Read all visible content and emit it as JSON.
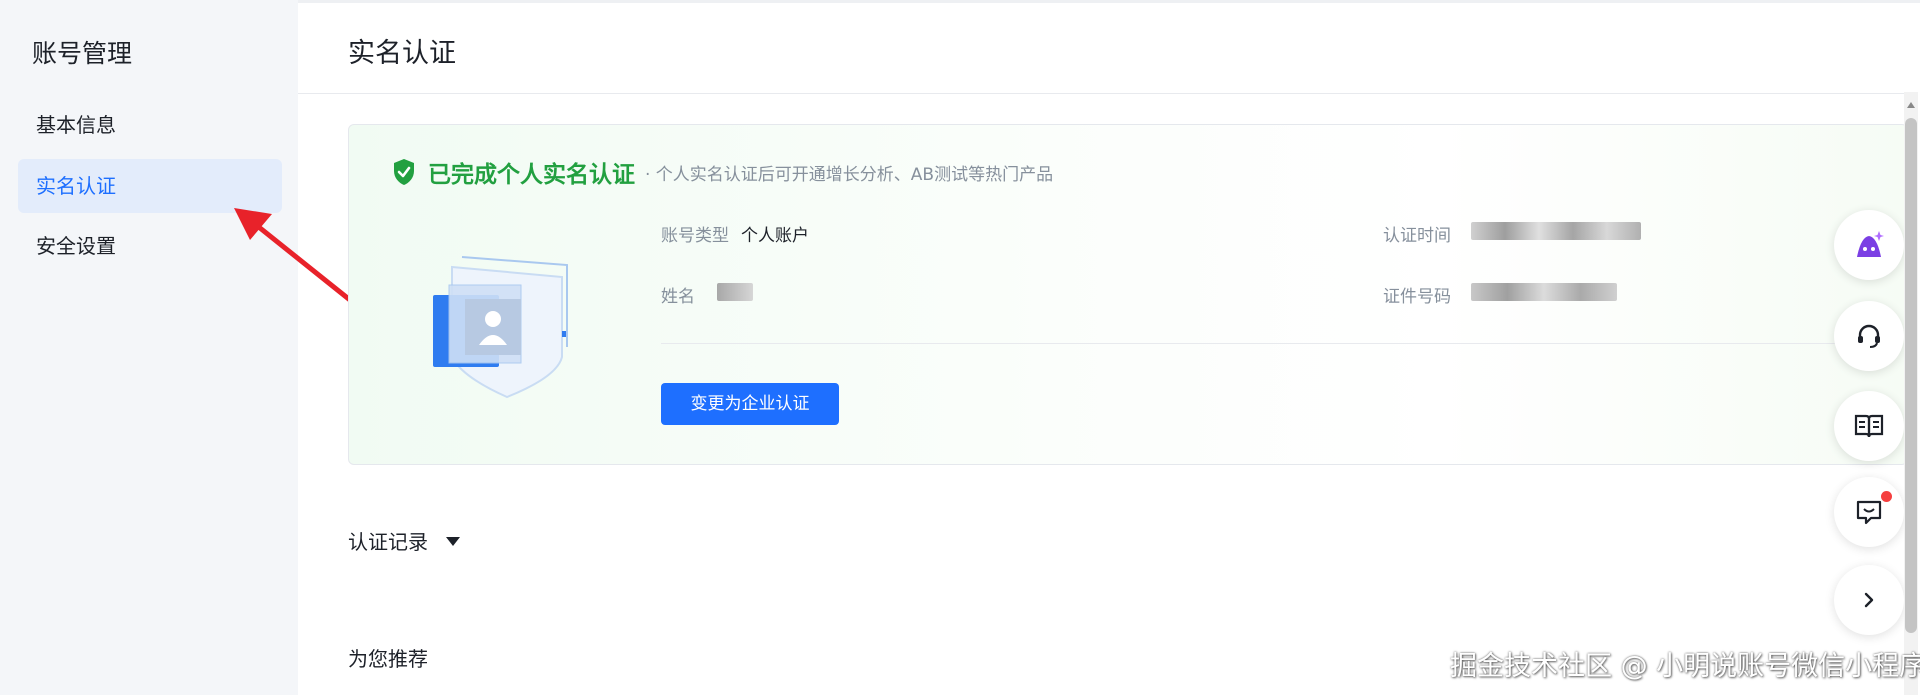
{
  "sidebar": {
    "title": "账号管理",
    "items": [
      {
        "label": "基本信息",
        "active": false
      },
      {
        "label": "实名认证",
        "active": true
      },
      {
        "label": "安全设置",
        "active": false
      }
    ]
  },
  "main": {
    "title": "实名认证",
    "card": {
      "status_title": "已完成个人实名认证",
      "status_note": "· 个人实名认证后可开通增长分析、AB测试等热门产品",
      "fields": {
        "account_type_label": "账号类型",
        "account_type_value": "个人账户",
        "name_label": "姓名",
        "auth_time_label": "认证时间",
        "id_number_label": "证件号码"
      },
      "change_button": "变更为企业认证"
    },
    "records_label": "认证记录",
    "recommend_label": "为您推荐"
  },
  "floating_buttons": [
    {
      "icon": "ai-assistant-icon"
    },
    {
      "icon": "headset-icon"
    },
    {
      "icon": "book-icon"
    },
    {
      "icon": "feedback-icon",
      "badge": true
    },
    {
      "icon": "chevron-right-icon"
    }
  ],
  "watermark": "掘金技术社区 @ 小明说账号微信小程序",
  "colors": {
    "primary": "#1e6fff",
    "success": "#22a040",
    "arrow": "#e8222a"
  }
}
